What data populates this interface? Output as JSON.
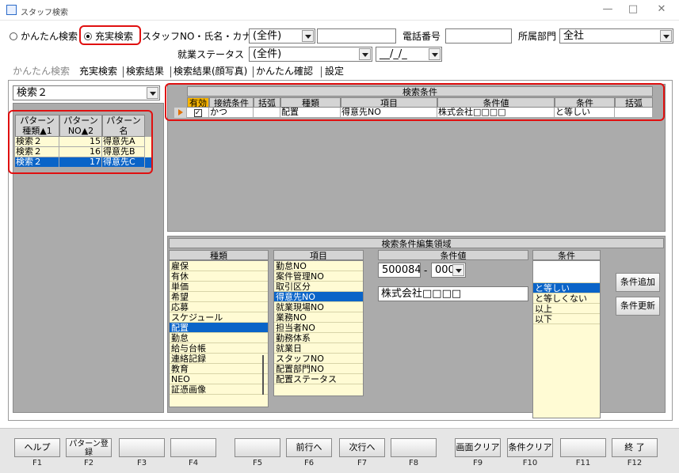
{
  "window": {
    "title": "スタッフ検索",
    "minimize": "—",
    "maximize": "□",
    "close": "✕"
  },
  "search_mode": {
    "simple": "かんたん検索",
    "full": "充実検索",
    "selected": "full"
  },
  "fields": {
    "staff_label": "スタッフNO・氏名・カナ",
    "staff_type_value": "(全件)",
    "staff_value": "",
    "phone_label": "電話番号",
    "phone_value": "",
    "dept_label": "所属部門",
    "dept_value": "全社",
    "employment_label": "就業ステータス",
    "employment_value": "(全件)",
    "date_value": "__/_/_"
  },
  "tabs": [
    "かんたん検索",
    "充実検索",
    "検索結果",
    "検索結果(顔写真)",
    "かんたん確認",
    "設定"
  ],
  "active_tab": 1,
  "pattern": {
    "selector_value": "検索２",
    "headers": [
      "パターン種類▲1",
      "パターンNO▲2",
      "パターン名"
    ],
    "rows": [
      {
        "type": "検索２",
        "no": "15",
        "name": "得意先A",
        "selected": false
      },
      {
        "type": "検索２",
        "no": "16",
        "name": "得意先B",
        "selected": false
      },
      {
        "type": "検索２",
        "no": "17",
        "name": "得意先C",
        "selected": true
      }
    ]
  },
  "conditions": {
    "title": "検索条件",
    "headers": [
      "有効",
      "接続条件",
      "括弧",
      "種類",
      "項目",
      "条件値",
      "条件",
      "括弧"
    ],
    "rows": [
      {
        "enabled": "✓",
        "connector": "かつ",
        "paren_open": "",
        "kind": "配置",
        "item": "得意先NO",
        "value": "株式会社□□□□",
        "op": "と等しい",
        "paren_close": ""
      }
    ]
  },
  "edit_area": {
    "title": "検索条件編集領域",
    "kind_header": "種類",
    "kinds": [
      "雇保",
      "有休",
      "単価",
      "希望",
      "応募",
      "スケジュール",
      "配置",
      "勤怠",
      "給与台帳",
      "連絡記録",
      "教育",
      "NEO",
      "証憑画像"
    ],
    "kind_selected": 6,
    "item_header": "項目",
    "items": [
      "勤怠NO",
      "案件管理NO",
      "取引区分",
      "得意先NO",
      "就業現場NO",
      "業務NO",
      "担当者NO",
      "勤務体系",
      "就業日",
      "スタッフNO",
      "配置部門NO",
      "配置ステータス"
    ],
    "item_selected": 3,
    "value_header": "条件値",
    "code_main": "500084",
    "code_sep": "-",
    "code_sub": "000",
    "value_name": "株式会社□□□□",
    "cond_header": "条件",
    "conds": [
      "",
      "と等しい",
      "と等しくない",
      "以上",
      "以下"
    ],
    "cond_selected": 1,
    "add_button": "条件追加",
    "update_button": "条件更新"
  },
  "function_keys": [
    {
      "key": "F1",
      "label": "ヘルプ"
    },
    {
      "key": "F2",
      "label": "パターン登録"
    },
    {
      "key": "F3",
      "label": ""
    },
    {
      "key": "F4",
      "label": ""
    },
    {
      "key": "F5",
      "label": ""
    },
    {
      "key": "F6",
      "label": "前行へ"
    },
    {
      "key": "F7",
      "label": "次行へ"
    },
    {
      "key": "F8",
      "label": ""
    },
    {
      "key": "F9",
      "label": "画面クリア"
    },
    {
      "key": "F10",
      "label": "条件クリア"
    },
    {
      "key": "F11",
      "label": ""
    },
    {
      "key": "F12",
      "label": "終 了"
    }
  ]
}
